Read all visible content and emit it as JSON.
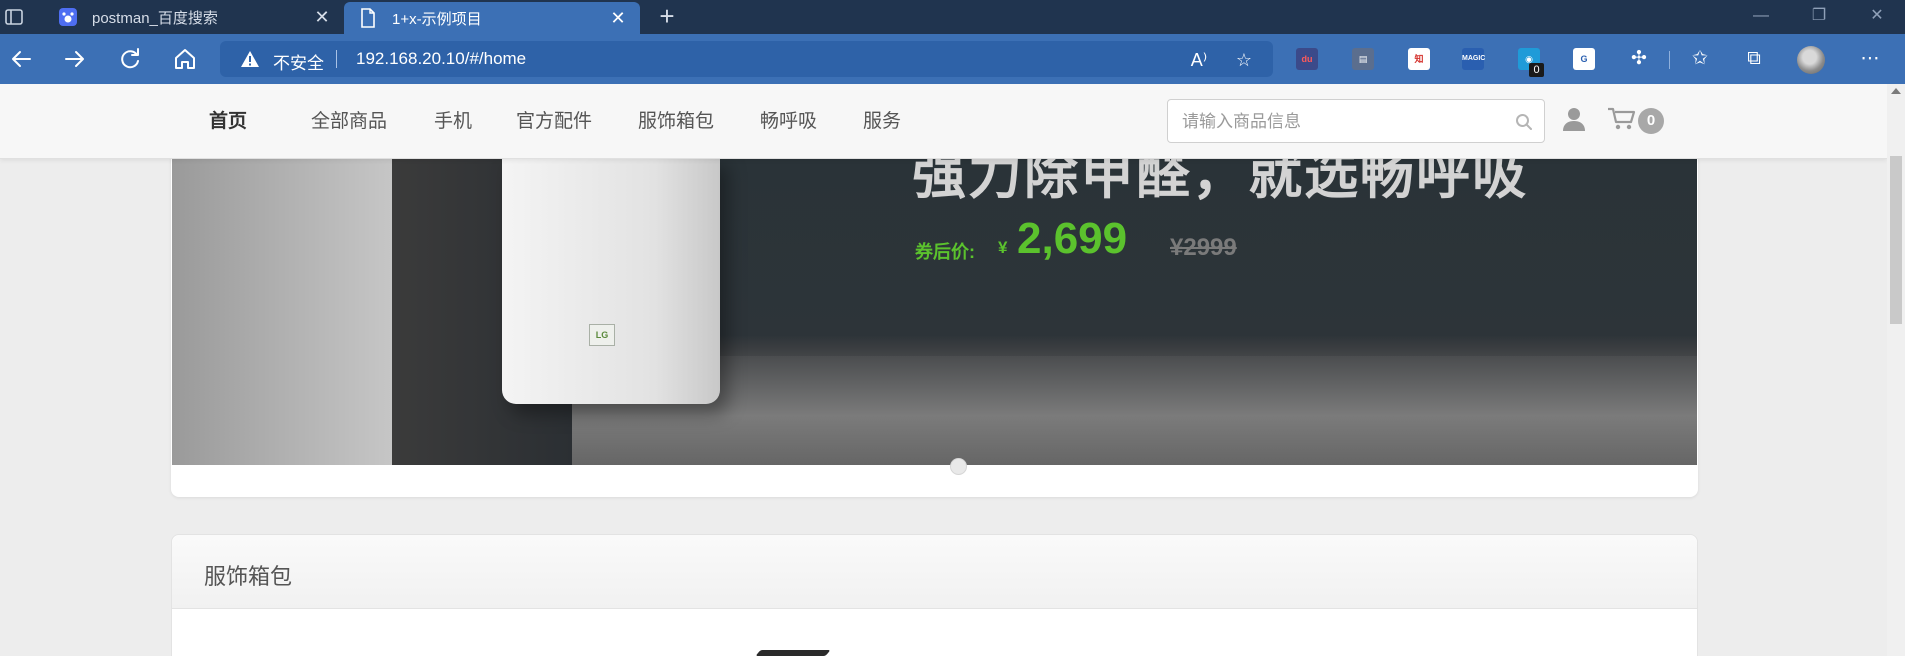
{
  "browser": {
    "tabs": [
      {
        "title": "postman_百度搜索",
        "active": false
      },
      {
        "title": "1+x-示例项目",
        "active": true
      }
    ],
    "address": {
      "security_label": "不安全",
      "url": "192.168.20.10/#/home"
    },
    "extensions_badge": "0",
    "icons": [
      "back-icon",
      "forward-icon",
      "refresh-icon",
      "home-icon",
      "read-aloud-icon",
      "add-favorite-icon",
      "extensions-icon",
      "favorites-icon",
      "collections-icon",
      "more-icon"
    ]
  },
  "site": {
    "nav": [
      "首页",
      "全部商品",
      "手机",
      "官方配件",
      "服饰箱包",
      "畅呼吸",
      "服务"
    ],
    "search": {
      "placeholder": "请输入商品信息",
      "value": ""
    },
    "cart_count": "0"
  },
  "banner": {
    "headline": "强力除甲醛，就选畅呼吸",
    "price_prefix": "券后价:",
    "currency": "¥",
    "price": "2,699",
    "old_price": "¥2999"
  },
  "section": {
    "title": "服饰箱包"
  },
  "colors": {
    "tabbar": "#20344f",
    "toolbar": "#3c70b5",
    "price_green": "#5bc22d"
  }
}
